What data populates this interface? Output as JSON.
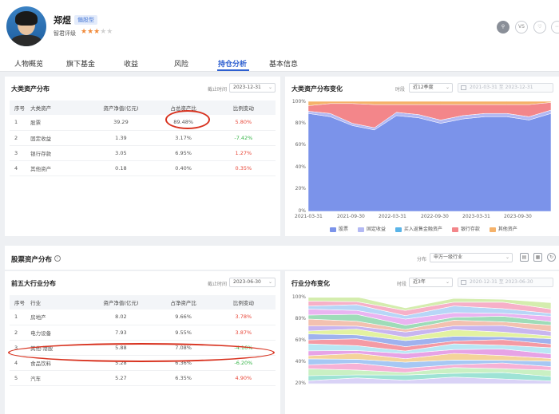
{
  "header": {
    "name": "郑煜",
    "style_tag": "偏股型",
    "rating_label": "智君评级",
    "stars_on": "★★★",
    "stars_off": "★★",
    "btn_vs": "VS"
  },
  "tabs": [
    "人物概览",
    "旗下基金",
    "收益",
    "风险",
    "持仓分析",
    "基本信息"
  ],
  "asset": {
    "title": "大类资产分布",
    "date_label": "截止时间",
    "date_value": "2023-12-31",
    "columns": [
      "序号",
      "大类资产",
      "资产净值(亿元)",
      "占总资产比",
      "比例变动"
    ],
    "rows": [
      {
        "no": "1",
        "name": "股票",
        "value": "39.29",
        "ratio": "89.48%",
        "change": "5.80%",
        "dir": "up"
      },
      {
        "no": "2",
        "name": "固定收益",
        "value": "1.39",
        "ratio": "3.17%",
        "change": "-7.42%",
        "dir": "down"
      },
      {
        "no": "3",
        "name": "银行存款",
        "value": "3.05",
        "ratio": "6.95%",
        "change": "1.27%",
        "dir": "up"
      },
      {
        "no": "4",
        "name": "其他资产",
        "value": "0.18",
        "ratio": "0.40%",
        "change": "0.35%",
        "dir": "up"
      }
    ]
  },
  "asset_chart": {
    "title": "大类资产分布变化",
    "period_label": "时段",
    "period_value": "近12季度",
    "date_range": "2021-03-31 至 2023-12-31",
    "y_ticks": [
      "100%",
      "80%",
      "60%",
      "40%",
      "20%",
      "0%"
    ],
    "x_ticks": [
      "2021-03-31",
      "2021-09-30",
      "2022-03-31",
      "2022-09-30",
      "2023-03-31",
      "2023-09-30"
    ],
    "legend": [
      {
        "name": "股票",
        "color": "#7b93ea"
      },
      {
        "name": "固定收益",
        "color": "#b3b9f4"
      },
      {
        "name": "买入返售金融资产",
        "color": "#5ab4e8"
      },
      {
        "name": "银行存款",
        "color": "#f3868a"
      },
      {
        "name": "其他资产",
        "color": "#f5b26a"
      }
    ]
  },
  "chart_data": [
    {
      "type": "area",
      "title": "大类资产分布变化",
      "x": [
        "2021-03-31",
        "2021-06-30",
        "2021-09-30",
        "2021-12-31",
        "2022-03-31",
        "2022-06-30",
        "2022-09-30",
        "2022-12-31",
        "2023-03-31",
        "2023-06-30",
        "2023-09-30",
        "2023-12-31"
      ],
      "ylim": [
        0,
        100
      ],
      "series": [
        {
          "name": "股票",
          "values": [
            89,
            86,
            78,
            74,
            87,
            85,
            80,
            84,
            86,
            86,
            83,
            89
          ]
        },
        {
          "name": "固定收益",
          "values": [
            2,
            3,
            2,
            2,
            3,
            3,
            3,
            3,
            3,
            3,
            3,
            3
          ]
        },
        {
          "name": "买入返售金融资产",
          "values": [
            0,
            0,
            0,
            0,
            0,
            0,
            0,
            0,
            0,
            0,
            0,
            0
          ]
        },
        {
          "name": "银行存款",
          "values": [
            5,
            9,
            18,
            21,
            7,
            9,
            14,
            10,
            8,
            8,
            11,
            7
          ]
        },
        {
          "name": "其他资产",
          "values": [
            4,
            2,
            2,
            3,
            3,
            3,
            3,
            3,
            3,
            3,
            3,
            1
          ]
        }
      ]
    }
  ],
  "stock": {
    "title": "股票资产分布",
    "dist_label": "分布",
    "dist_value": "申万一级行业",
    "top5_title": "前五大行业分布",
    "date_label": "截止时间",
    "date_value": "2023-06-30",
    "columns": [
      "序号",
      "行业",
      "资产净值(亿元)",
      "占净资产比",
      "比例变动"
    ],
    "rows": [
      {
        "no": "1",
        "name": "房地产",
        "value": "8.02",
        "ratio": "9.66%",
        "change": "3.78%",
        "dir": "up"
      },
      {
        "no": "2",
        "name": "电力设备",
        "value": "7.93",
        "ratio": "9.55%",
        "change": "3.87%",
        "dir": "up"
      },
      {
        "no": "3",
        "name": "其他-港股",
        "value": "5.88",
        "ratio": "7.08%",
        "change": "-4.16%",
        "dir": "down"
      },
      {
        "no": "4",
        "name": "食品饮料",
        "value": "5.28",
        "ratio": "6.36%",
        "change": "-6.20%",
        "dir": "down"
      },
      {
        "no": "5",
        "name": "汽车",
        "value": "5.27",
        "ratio": "6.35%",
        "change": "4.90%",
        "dir": "up"
      }
    ]
  },
  "industry_chart": {
    "title": "行业分布变化",
    "period_label": "时段",
    "period_value": "近3年",
    "date_range": "2020-12-31 至 2023-06-30",
    "y_ticks": [
      "100%",
      "80%",
      "60%",
      "40%",
      "20%"
    ]
  }
}
